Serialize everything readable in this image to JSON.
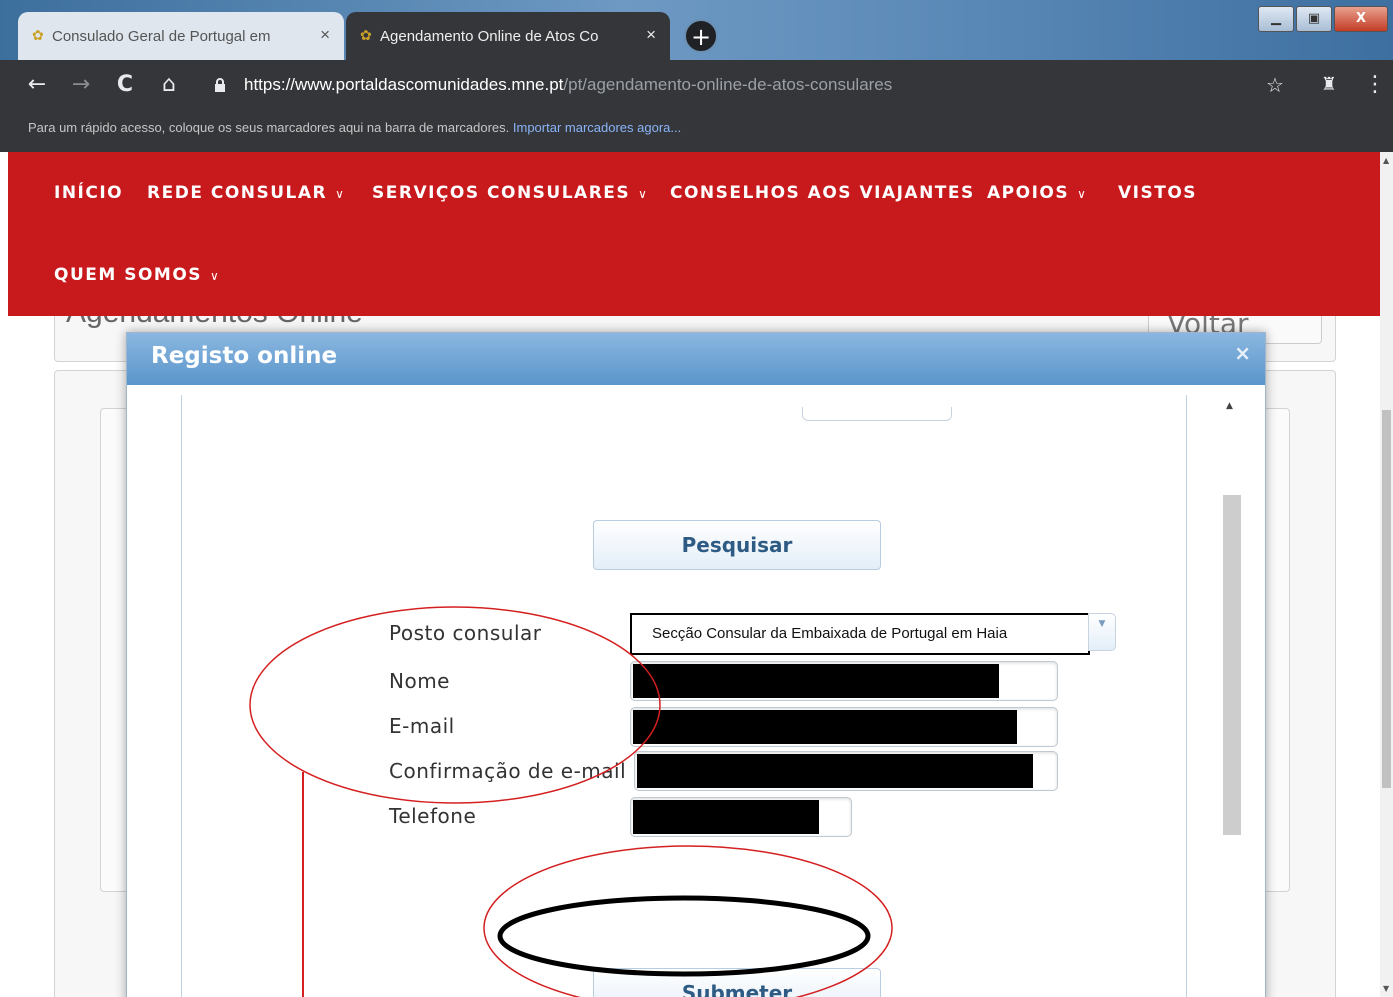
{
  "browser": {
    "tabs": [
      {
        "title": "Consulado Geral de Portugal em",
        "active": false
      },
      {
        "title": "Agendamento Online de Atos Co",
        "active": true
      }
    ],
    "url_host": "https://www.portaldascomunidades.mne.pt",
    "url_path": "/pt/agendamento-online-de-atos-consulares",
    "bookmarks_bar_text": "Para um rápido acesso, coloque os seus marcadores aqui na barra de marcadores.",
    "bookmarks_import_link": "Importar marcadores agora..."
  },
  "site_nav": {
    "items": [
      {
        "label": "INÍCIO",
        "has_dropdown": false
      },
      {
        "label": "REDE CONSULAR",
        "has_dropdown": true
      },
      {
        "label": "SERVIÇOS CONSULARES",
        "has_dropdown": true
      },
      {
        "label": "CONSELHOS AOS VIAJANTES",
        "has_dropdown": false
      },
      {
        "label": "APOIOS",
        "has_dropdown": true
      },
      {
        "label": "VISTOS",
        "has_dropdown": false
      },
      {
        "label": "QUEM SOMOS",
        "has_dropdown": true
      }
    ]
  },
  "background": {
    "page_title": "Agendamentos Online",
    "voltar_label": "Voltar"
  },
  "modal": {
    "title": "Registo online",
    "close_symbol": "×",
    "search_button": "Pesquisar",
    "form": {
      "posto_label": "Posto consular",
      "posto_value": "Secção Consular da Embaixada de Portugal em Haia",
      "nome_label": "Nome",
      "email_label": "E-mail",
      "confirm_email_label": "Confirmação de e-mail",
      "telefone_label": "Telefone"
    },
    "submit_button": "Submeter"
  },
  "colors": {
    "nav_red": "#c8191d",
    "modal_header": "#6fa3d4",
    "annotation_red": "#d42020",
    "annotation_black": "#000000"
  }
}
